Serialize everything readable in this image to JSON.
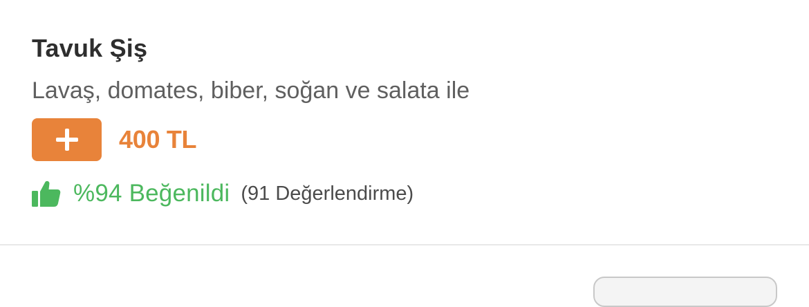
{
  "product": {
    "name": "Tavuk Şiş",
    "description": "Lavaş, domates, biber, soğan ve salata ile",
    "price": "400 TL",
    "add_button_icon": "plus-icon",
    "rating": {
      "icon": "thumbs-up-icon",
      "liked_text": "%94 Beğenildi",
      "review_count_text": "(91 Değerlendirme)"
    }
  },
  "colors": {
    "accent_orange": "#E8833A",
    "rating_green": "#4CB85E",
    "title_text": "#2E2E2E",
    "description_text": "#5F5F5F",
    "divider": "#E8E8E8"
  }
}
